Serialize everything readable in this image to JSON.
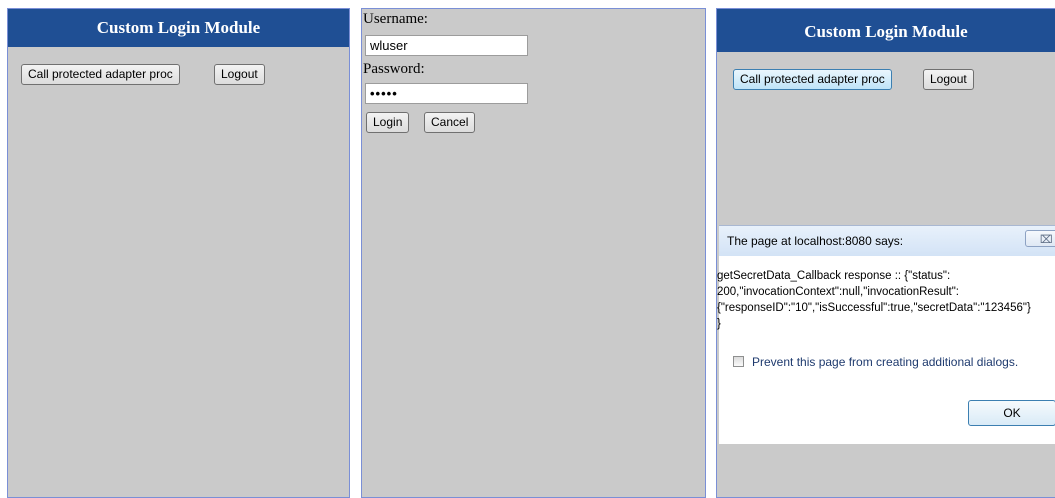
{
  "left_panel": {
    "title": "Custom Login Module",
    "call_button_label": "Call protected adapter proc",
    "logout_button_label": "Logout"
  },
  "login_panel": {
    "username_label": "Username:",
    "username_value": "wluser",
    "password_label": "Password:",
    "password_value": "•••••",
    "login_button_label": "Login",
    "cancel_button_label": "Cancel"
  },
  "right_panel": {
    "title": "Custom Login Module",
    "call_button_label": "Call protected adapter proc",
    "logout_button_label": "Logout"
  },
  "dialog": {
    "title": "The page at localhost:8080 says:",
    "close_glyph": "⌧",
    "message": "getSecretData_Callback response :: {\"status\":\n200,\"invocationContext\":null,\"invocationResult\":\n{\"responseID\":\"10\",\"isSuccessful\":true,\"secretData\":\"123456\"}\n}",
    "prevent_label": "Prevent this page from creating additional dialogs.",
    "ok_label": "OK"
  }
}
